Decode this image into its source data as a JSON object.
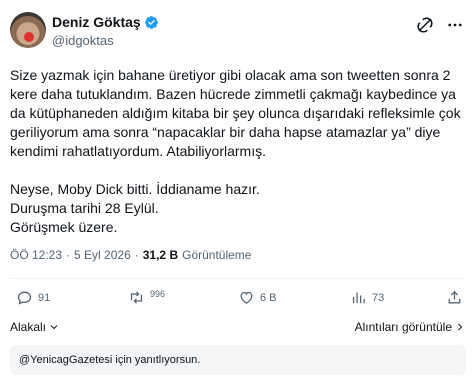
{
  "author": {
    "name": "Deniz Göktaş",
    "handle": "@idgoktas",
    "verified": true
  },
  "header_icons": [
    "grok-icon",
    "more-icon"
  ],
  "tweet": {
    "paragraph1": "Size yazmak için bahane üretiyor gibi olacak ama son tweetten sonra 2\nkere daha tutuklandım. Bazen hücrede zimmetli çakmağı kaybedince ya\nda kütüphaneden aldığım kitaba bir şey olunca dışarıdaki refleksimle çok\ngeriliyorum ama sonra “napacaklar bir daha hapse atamazlar ya” diye\nkendimi rahatlatıyordum. Atabiliyorlarmış.",
    "paragraph2": "Neyse, Moby Dick bitti. İddianame hazır.\nDuruşma tarihi 28 Eylül.\nGörüşmek üzere."
  },
  "meta": {
    "time": "ÖÖ 12:23",
    "separator": "·",
    "date": "5 Eyl 2026",
    "separator2": "·",
    "views_count": "31,2 B",
    "views_label": "Görüntüleme"
  },
  "actions": {
    "replies": "91",
    "reposts": "996",
    "likes": "6 B",
    "bookmarks": "73"
  },
  "reply_bar": {
    "left_label": "Alakalı",
    "right_label": "Alıntıları görüntüle"
  },
  "replying_notice": "@YenicagGazetesi için yanıtlıyorsun.",
  "colors": {
    "text": "#0f1419",
    "secondary": "#536471",
    "verified": "#1d9bf0",
    "divider": "#eff3f4"
  }
}
